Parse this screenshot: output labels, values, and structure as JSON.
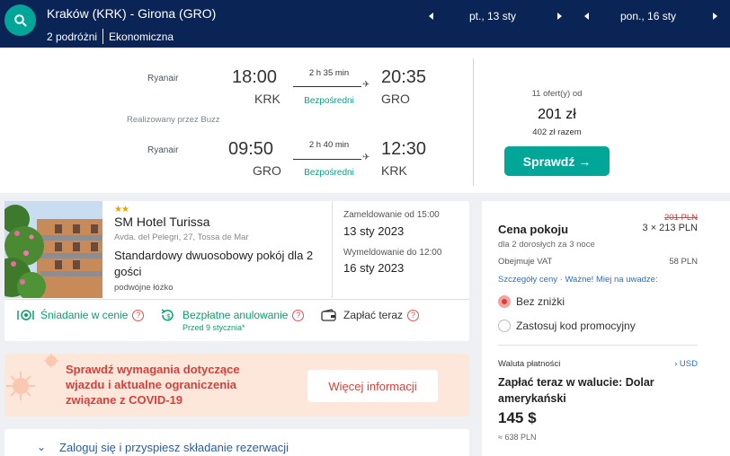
{
  "header": {
    "route": "Kraków (KRK) - Girona (GRO)",
    "travellers": "2 podróżni",
    "cabin": "Ekonomiczna",
    "depart_date": "pt., 13 sty",
    "return_date": "pon., 16 sty"
  },
  "flights": {
    "outbound": {
      "airline": "Ryanair",
      "operated_by": "Realizowany przez Buzz",
      "dep_time": "18:00",
      "dep_code": "KRK",
      "duration": "2 h 35 min",
      "stops": "Bezpośredni",
      "arr_time": "20:35",
      "arr_code": "GRO"
    },
    "inbound": {
      "airline": "Ryanair",
      "dep_time": "09:50",
      "dep_code": "GRO",
      "duration": "2 h 40 min",
      "stops": "Bezpośredni",
      "arr_time": "12:30",
      "arr_code": "KRK"
    },
    "offers": "11 ofert(y) od",
    "price": "201 zł",
    "total": "402 zł razem",
    "cta": "Sprawdź →"
  },
  "hotel": {
    "stars": "★★",
    "name": "SM Hotel Turissa",
    "address": "Avda. del Pelegri, 27, Tossa de Mar",
    "room": "Standardowy dwuosobowy pokój dla 2 gości",
    "bed": "podwójne łóżko",
    "checkin_label": "Zameldowanie od 15:00",
    "checkin_date": "13 sty 2023",
    "checkout_label": "Wymeldowanie do 12:00",
    "checkout_date": "16 sty 2023",
    "features": {
      "breakfast": "Śniadanie w cenie",
      "cancel": "Bezpłatne anulowanie",
      "cancel_sub": "Przed 9 stycznia*",
      "pay_now": "Zapłać teraz"
    }
  },
  "covid": {
    "text": "Sprawdź wymagania dotyczące wjazdu i aktualne ograniczenia związane z COVID-19",
    "button": "Więcej informacji"
  },
  "login": {
    "text": "Zaloguj się i przyspiesz składanie rezerwacji"
  },
  "price_panel": {
    "title": "Cena pokoju",
    "old_price": "201 PLN",
    "multiplier": "3 × 213 PLN",
    "subtitle": "dla 2 dorosłych  za 3 noce",
    "vat_label": "Obejmuje VAT",
    "vat_value": "58 PLN",
    "links": "Szczegóły ceny · Ważne! Miej na uwadze:",
    "option_no_discount": "Bez zniżki",
    "option_promo": "Zastosuj kod promocyjny",
    "currency_label": "Waluta płatności",
    "currency_value": "› USD",
    "pay_label": "Zapłać teraz w walucie: Dolar amerykański",
    "pay_value": "145 $",
    "pay_pln": "≈ 638 PLN"
  },
  "colors": {
    "navy": "#0b2456",
    "teal": "#00a698",
    "red": "#d6403a",
    "green": "#0a9f6a"
  }
}
